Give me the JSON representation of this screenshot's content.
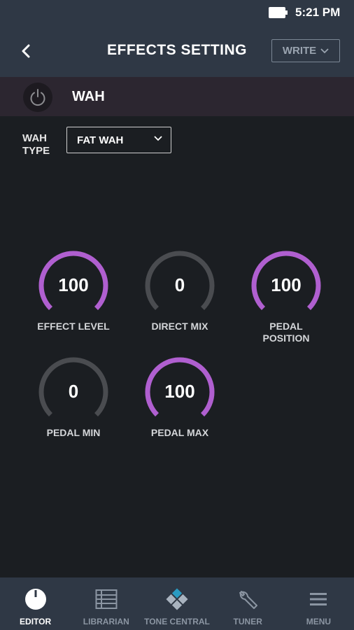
{
  "status_bar": {
    "time": "5:21 PM"
  },
  "header": {
    "title": "EFFECTS SETTING",
    "write_label": "WRITE"
  },
  "effect": {
    "name": "WAH",
    "type_label_line1": "WAH",
    "type_label_line2": "TYPE",
    "type_value": "FAT WAH"
  },
  "knobs": [
    {
      "value": "100",
      "label_line1": "EFFECT LEVEL",
      "label_line2": "",
      "fraction": 1.0
    },
    {
      "value": "0",
      "label_line1": "DIRECT MIX",
      "label_line2": "",
      "fraction": 0.0
    },
    {
      "value": "100",
      "label_line1": "PEDAL",
      "label_line2": "POSITION",
      "fraction": 1.0
    },
    {
      "value": "0",
      "label_line1": "PEDAL MIN",
      "label_line2": "",
      "fraction": 0.0
    },
    {
      "value": "100",
      "label_line1": "PEDAL MAX",
      "label_line2": "",
      "fraction": 1.0
    }
  ],
  "nav": [
    {
      "label": "EDITOR",
      "icon": "power-knob-icon",
      "active": true
    },
    {
      "label": "LIBRARIAN",
      "icon": "library-grid-icon",
      "active": false
    },
    {
      "label": "TONE CENTRAL",
      "icon": "tone-central-icon",
      "active": false
    },
    {
      "label": "TUNER",
      "icon": "wrench-icon",
      "active": false
    },
    {
      "label": "MENU",
      "icon": "menu-icon",
      "active": false
    }
  ],
  "colors": {
    "accent": "#b05fd0",
    "track": "#4a4c50",
    "bar": "#2f3845",
    "effect_header": "#2c2630"
  }
}
